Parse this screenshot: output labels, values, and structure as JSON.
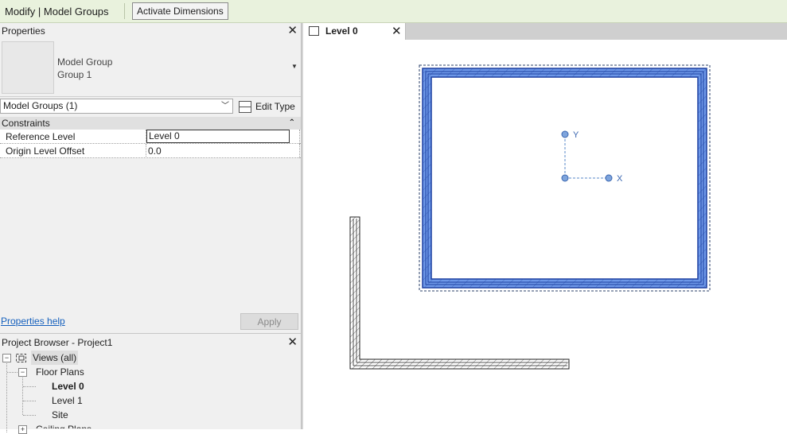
{
  "ribbon": {
    "context_label": "Modify | Model Groups",
    "activate_dimensions_label": "Activate Dimensions"
  },
  "properties": {
    "title": "Properties",
    "type_line1": "Model Group",
    "type_line2": "Group 1",
    "selector_value": "Model Groups (1)",
    "edit_type_label": "Edit Type",
    "group_label": "Constraints",
    "rows": [
      {
        "label": "Reference Level",
        "value": "Level 0"
      },
      {
        "label": "Origin Level Offset",
        "value": "0.0"
      }
    ],
    "help_label": "Properties help",
    "apply_label": "Apply"
  },
  "project_browser": {
    "title": "Project Browser - Project1",
    "views_label": "Views (all)",
    "floor_plans_label": "Floor Plans",
    "floor_plans": [
      "Level 0",
      "Level 1",
      "Site"
    ],
    "active_view": "Level 0",
    "ceiling_plans_label": "Ceiling Plans"
  },
  "view_tab": {
    "label": "Level 0"
  },
  "canvas": {
    "axis_x_label": "X",
    "axis_y_label": "Y",
    "colors": {
      "selection_blue": "#3e6fd8",
      "wall_fill": "#6e98e8",
      "origin_marker": "#5a8ac8"
    }
  }
}
